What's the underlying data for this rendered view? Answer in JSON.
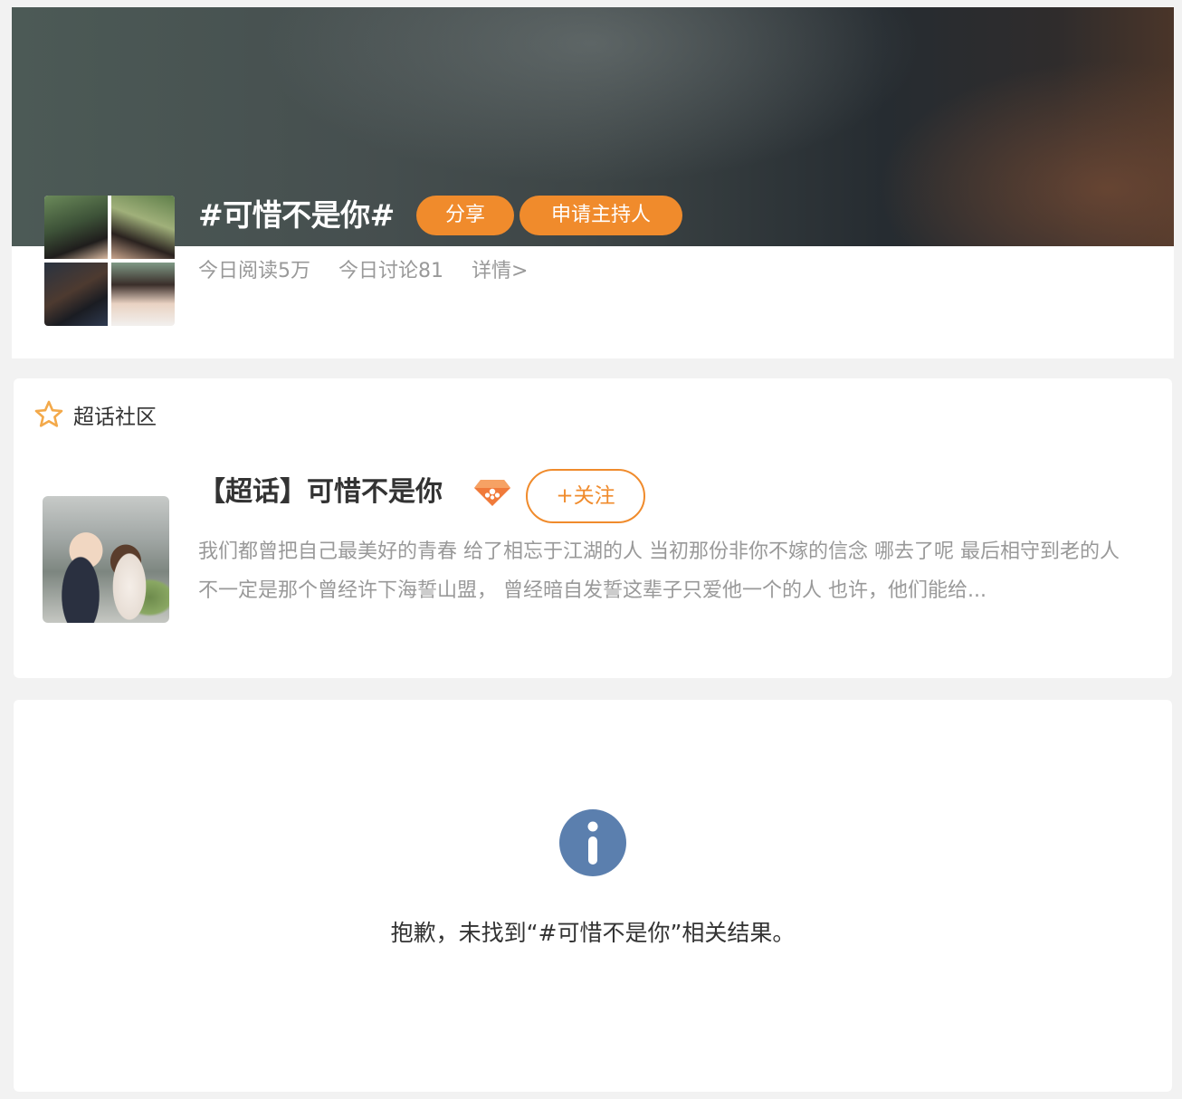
{
  "topic": {
    "title": "#可惜不是你#",
    "share_label": "分享",
    "apply_host_label": "申请主持人",
    "stats": {
      "reads": "今日阅读5万",
      "discussions": "今日讨论81",
      "details_link": "详情>"
    }
  },
  "super_topic": {
    "section_label": "超话社区",
    "name": "【超话】可惜不是你",
    "follow_label": "+关注",
    "description": "我们都曾把自己最美好的青春 给了相忘于江湖的人 当初那份非你不嫁的信念 哪去了呢 最后相守到老的人 不一定是那个曾经许下海誓山盟， 曾经暗自发誓这辈子只爱他一个的人 也许，他们能给..."
  },
  "result": {
    "empty_message": "抱歉，未找到“#可惜不是你”相关结果。"
  },
  "colors": {
    "accent": "#f08b2c",
    "info_icon": "#5b7fae",
    "muted_text": "#999999",
    "main_text": "#333333"
  },
  "icons": {
    "section": "star-outline-icon",
    "badge": "diamond-icon",
    "empty_state": "info-circle-icon"
  }
}
